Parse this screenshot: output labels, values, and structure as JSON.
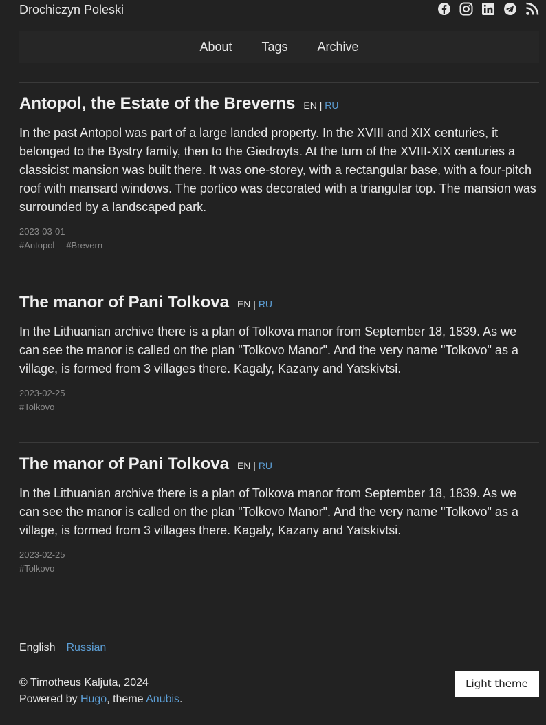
{
  "site": {
    "title": "Drochiczyn Poleski"
  },
  "social": [
    {
      "name": "facebook-icon"
    },
    {
      "name": "instagram-icon"
    },
    {
      "name": "linkedin-icon"
    },
    {
      "name": "telegram-icon"
    },
    {
      "name": "rss-icon"
    }
  ],
  "nav": {
    "about": "About",
    "tags": "Tags",
    "archive": "Archive"
  },
  "posts": [
    {
      "title": "Antopol, the Estate of the Breverns",
      "lang_en": "EN",
      "lang_sep": "|",
      "lang_ru": "RU",
      "body": "In the past Antopol was part of a large landed property. In the XVIII and XIX centuries, it belonged to the Bystry family, then to the Giedroyts. At the turn of the XVIII-XIX centuries a classicist mansion was built there. It was one-storey, with a rectangular base, with a four-pitch roof with mansard windows. The portico was decorated with a triangular top. The mansion was surrounded by a landscaped park.",
      "date": "2023-03-01",
      "tags": [
        "#Antopol",
        "#Brevern"
      ]
    },
    {
      "title": "The manor of Pani Tolkova",
      "lang_en": "EN",
      "lang_sep": "|",
      "lang_ru": "RU",
      "body": "In the Lithuanian archive there is a plan of Tolkova manor from September 18, 1839. As we can see the manor is called on the plan \"Tolkovo Manor\". And the very name \"Tolkovo\" as a village, is formed from 3 villages there. Kagaly, Kazany and Yatskivtsi.",
      "date": "2023-02-25",
      "tags": [
        "#Tolkovo"
      ]
    },
    {
      "title": "The manor of Pani Tolkova",
      "lang_en": "EN",
      "lang_sep": "|",
      "lang_ru": "RU",
      "body": "In the Lithuanian archive there is a plan of Tolkova manor from September 18, 1839. As we can see the manor is called on the plan \"Tolkovo Manor\". And the very name \"Tolkovo\" as a village, is formed from 3 villages there. Kagaly, Kazany and Yatskivtsi.",
      "date": "2023-02-25",
      "tags": [
        "#Tolkovo"
      ]
    }
  ],
  "footer": {
    "lang_current": "English",
    "lang_other": "Russian",
    "copyright": "© Timotheus Kaljuta, 2024",
    "powered_prefix": "Powered by ",
    "hugo": "Hugo",
    "theme_mid": ", theme ",
    "anubis": "Anubis",
    "period": ".",
    "theme_button": "Light theme"
  },
  "colors": {
    "background": "#222222",
    "link": "#5d9fd6",
    "muted": "#8a8a8a"
  }
}
